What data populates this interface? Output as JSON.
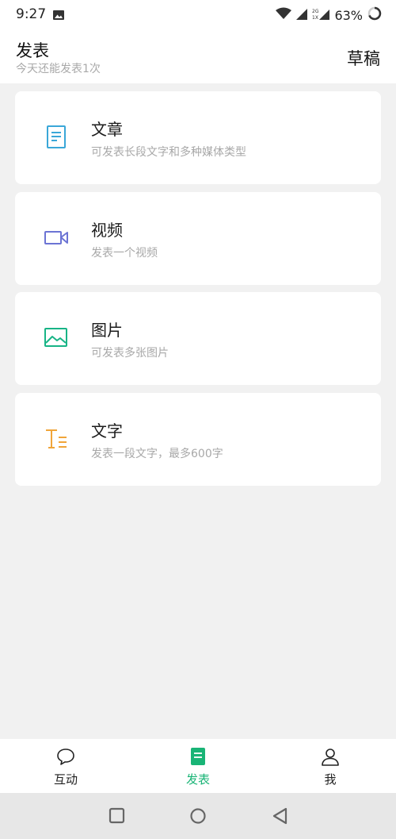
{
  "status_bar": {
    "time": "9:27",
    "battery": "63%",
    "icons": [
      "gallery-icon",
      "wifi-icon",
      "signal-icon",
      "network-2g-icon",
      "battery-icon"
    ]
  },
  "header": {
    "title": "发表",
    "subtitle": "今天还能发表1次",
    "draft_label": "草稿"
  },
  "cards": [
    {
      "title": "文章",
      "description": "可发表长段文字和多种媒体类型",
      "icon": "article-icon",
      "color": "#3aa7d8"
    },
    {
      "title": "视频",
      "description": "发表一个视频",
      "icon": "video-icon",
      "color": "#6c74d4"
    },
    {
      "title": "图片",
      "description": "可发表多张图片",
      "icon": "image-icon",
      "color": "#18b486"
    },
    {
      "title": "文字",
      "description": "发表一段文字，最多600字",
      "icon": "text-icon",
      "color": "#f0a53a"
    }
  ],
  "bottom_nav": {
    "items": [
      {
        "label": "互动",
        "icon": "chat-bubble-icon",
        "active": false
      },
      {
        "label": "发表",
        "icon": "document-icon",
        "active": true
      },
      {
        "label": "我",
        "icon": "person-icon",
        "active": false
      }
    ],
    "active_color": "#19b476"
  },
  "system_nav": {
    "buttons": [
      "recents-button",
      "home-button",
      "back-button"
    ]
  }
}
